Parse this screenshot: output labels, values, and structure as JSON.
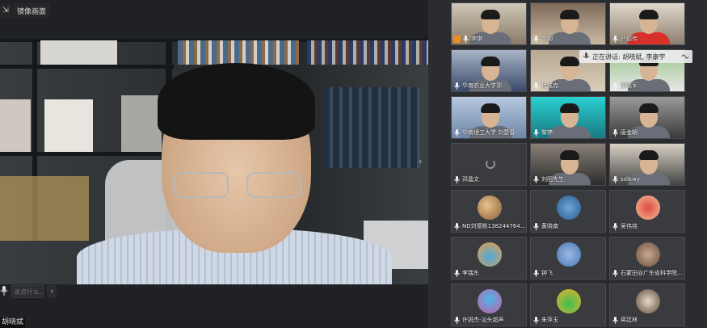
{
  "top_bar": {
    "icon_label": "⇲",
    "title": "镜像画面"
  },
  "speaker": {
    "name": "胡晓斌"
  },
  "controls": {
    "chat_placeholder": "说点什么...",
    "collapse_glyph": "‹"
  },
  "right_nav": {
    "chevron": "›"
  },
  "speaking_banner": {
    "text": "正在讲话: 胡晓斌, 李康宇"
  },
  "participants": [
    {
      "name": "李琪",
      "type": "video",
      "host": true
    },
    {
      "name": "曾刚",
      "type": "video"
    },
    {
      "name": "严德传",
      "type": "video"
    },
    {
      "name": "华南农业大学郭",
      "type": "video"
    },
    {
      "name": "杜成克",
      "type": "video"
    },
    {
      "name": "张晓军",
      "type": "video"
    },
    {
      "name": "华南理工大学 刘楚春",
      "type": "video"
    },
    {
      "name": "黎婷",
      "type": "video"
    },
    {
      "name": "唐金朝",
      "type": "video"
    },
    {
      "name": "邓晶文",
      "type": "loading"
    },
    {
      "name": "刘阳先生",
      "type": "video"
    },
    {
      "name": "sdlkwy",
      "type": "video"
    },
    {
      "name": "ND刘德彬13824476473",
      "type": "avatar"
    },
    {
      "name": "黄晓南",
      "type": "avatar"
    },
    {
      "name": "吴伟铭",
      "type": "avatar"
    },
    {
      "name": "李瑞东",
      "type": "avatar"
    },
    {
      "name": "钟飞",
      "type": "avatar"
    },
    {
      "name": "石蒙田@广东省科学院工...",
      "type": "avatar"
    },
    {
      "name": "许锐杰-汕头超声",
      "type": "avatar"
    },
    {
      "name": "朱萍玉",
      "type": "avatar"
    },
    {
      "name": "蒋廷林",
      "type": "avatar"
    }
  ],
  "colors": {
    "speaking_border": "#30c85a",
    "host_badge": "#f08a24"
  }
}
